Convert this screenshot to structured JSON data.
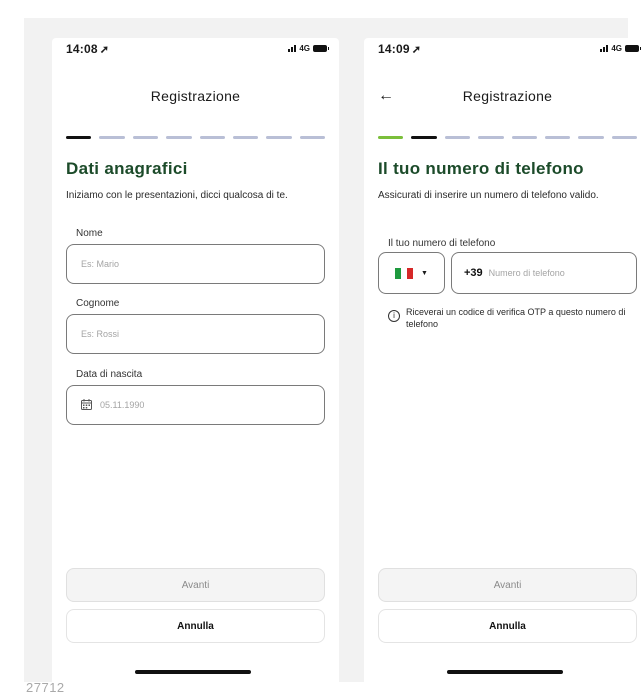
{
  "colors": {
    "heading": "#1c4b2a",
    "step_done": "#7bbf3b",
    "step_active": "#111111",
    "step_pending": "#b9bfd6"
  },
  "screen1": {
    "status": {
      "time": "14:08",
      "network": "4G",
      "location_icon": "location-arrow-icon"
    },
    "nav": {
      "title": "Registrazione"
    },
    "progress": {
      "current_step": 1,
      "total_steps": 8
    },
    "heading": "Dati anagrafici",
    "description": "Iniziamo con le presentazioni, dicci qualcosa di te.",
    "fields": {
      "nome": {
        "label": "Nome",
        "placeholder": "Es: Mario"
      },
      "cognome": {
        "label": "Cognome",
        "placeholder": "Es: Rossi"
      },
      "data_nascita": {
        "label": "Data di nascita",
        "placeholder": "05.11.1990",
        "icon": "calendar-icon"
      }
    },
    "buttons": {
      "next": "Avanti",
      "cancel": "Annulla"
    }
  },
  "screen2": {
    "status": {
      "time": "14:09",
      "network": "4G",
      "location_icon": "location-arrow-icon"
    },
    "nav": {
      "title": "Registrazione",
      "back_icon": "arrow-left-icon"
    },
    "progress": {
      "current_step": 2,
      "total_steps": 8
    },
    "heading": "Il tuo numero di telefono",
    "description": "Assicurati di inserire un numero di telefono valido.",
    "phone": {
      "label": "Il tuo numero di telefono",
      "country_flag": "italy-flag-icon",
      "prefix": "+39",
      "placeholder": "Numero di telefono"
    },
    "info": {
      "icon": "info-icon",
      "text": "Riceverai un codice di verifica OTP a questo numero di telefono"
    },
    "buttons": {
      "next": "Avanti",
      "cancel": "Annulla"
    }
  },
  "caption": "27712"
}
